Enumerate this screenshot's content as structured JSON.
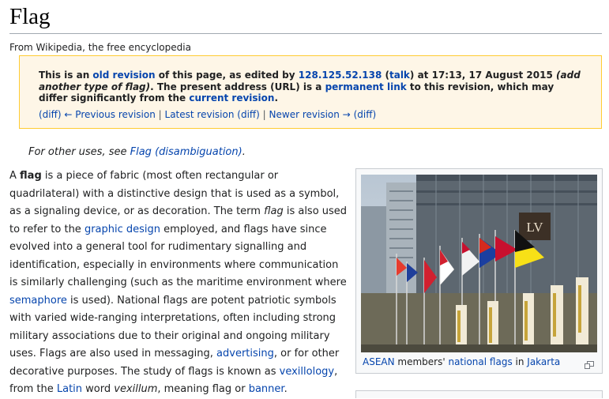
{
  "page": {
    "title": "Flag",
    "site_sub": "From Wikipedia, the free encyclopedia"
  },
  "revision_notice": {
    "t1": "This is an ",
    "old_revision": "old revision",
    "t2": " of this page, as edited by ",
    "ip": "128.125.52.138",
    "t3": " (",
    "talk": "talk",
    "t4": ") at 17:13, 17 August 2015 ",
    "add_type": "(add another type of flag)",
    "t5": ". The present address (URL) is a ",
    "permanent_link": "permanent link",
    "t6": " to this revision, which may differ significantly from the ",
    "current_revision": "current revision",
    "t7": "."
  },
  "revision_nav": {
    "diff1": "(diff)",
    "previous": "← Previous revision",
    "sep1": " | ",
    "latest": "Latest revision",
    "diff2": "(diff)",
    "sep2": " | ",
    "newer": "Newer revision →",
    "diff3": "(diff)"
  },
  "hatnote": {
    "text": "For other uses, see ",
    "link": "Flag (disambiguation)",
    "end": "."
  },
  "lead": {
    "s1": "A ",
    "bold": "flag",
    "s2": " is a piece of fabric (most often rectangular or quadrilateral) with a distinctive design that is used as a symbol, as a signaling device, or as decoration. The term ",
    "italic1": "flag",
    "s3": " is also used to refer to the ",
    "link_graphic": "graphic design",
    "s4": " employed, and flags have since evolved into a general tool for rudimentary signalling and identification, especially in environments where communication is similarly challenging (such as the maritime environment where ",
    "link_semaphore": "semaphore",
    "s5": " is used). National flags are potent patriotic symbols with varied wide-ranging interpretations, often including strong military associations due to their original and ongoing military uses. Flags are also used in messaging, ",
    "link_advertising": "advertising",
    "s6": ", or for other decorative purposes. The study of flags is known as ",
    "link_vexillology": "vexillology",
    "s7": ", from the ",
    "link_latin": "Latin",
    "s8": " word ",
    "italic2": "vexillum",
    "s9": ", meaning flag or ",
    "link_banner": "banner",
    "s10": "."
  },
  "thumb": {
    "cap_link1": "ASEAN",
    "cap_t1": " members' ",
    "cap_link2": "national flags",
    "cap_t2": " in ",
    "cap_link3": "Jakarta",
    "billboard": "LV",
    "icon": "magnify-icon"
  },
  "colors": {
    "link": "#0645ad",
    "notice_bg": "#fef6e7",
    "notice_border": "#ffcc33",
    "thumb_border": "#c8ccd1"
  }
}
